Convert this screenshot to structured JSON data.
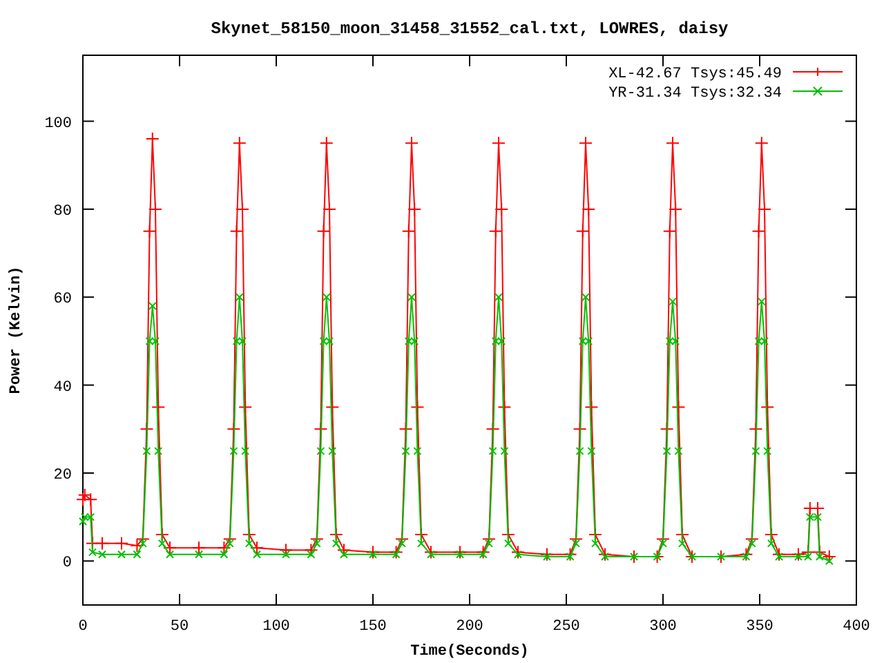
{
  "chart_data": {
    "type": "line",
    "title": "Skynet_58150_moon_31458_31552_cal.txt, LOWRES, daisy",
    "xlabel": "Time(Seconds)",
    "ylabel": "Power (Kelvin)",
    "x": [
      0,
      1,
      4,
      5,
      10,
      20,
      28,
      31,
      33,
      34.5,
      36,
      37.5,
      39,
      41,
      45,
      60,
      73,
      76,
      78,
      79.5,
      81,
      82.5,
      84,
      86,
      90,
      105,
      118,
      121,
      123,
      124.5,
      126,
      127.5,
      129,
      131,
      135,
      150,
      162,
      165,
      167,
      168.5,
      170,
      171.5,
      173,
      175,
      180,
      195,
      207,
      210,
      212,
      213.5,
      215,
      216.5,
      218,
      220,
      225,
      240,
      252,
      255,
      257,
      258.5,
      260,
      261.5,
      263,
      265,
      270,
      285,
      297,
      300,
      302,
      303.5,
      305,
      306.5,
      308,
      310,
      315,
      330,
      343,
      346,
      348,
      349.5,
      351,
      352.5,
      354,
      356,
      360,
      370,
      375,
      376,
      380,
      381,
      386
    ],
    "series": [
      {
        "name": "XL-42.67 Tsys:45.49",
        "color": "#ff0000",
        "marker": "plus",
        "values": [
          14,
          15,
          14,
          4,
          4,
          4,
          3.5,
          5,
          30,
          75,
          96,
          80,
          35,
          6,
          3,
          3,
          3,
          5,
          30,
          75,
          95,
          80,
          35,
          6,
          3,
          2.5,
          2.5,
          5,
          30,
          75,
          95,
          80,
          35,
          6,
          2.5,
          2,
          2,
          5,
          30,
          75,
          95,
          80,
          35,
          6,
          2,
          2,
          2,
          5,
          30,
          75,
          95,
          80,
          35,
          6,
          2,
          1.5,
          1.5,
          5,
          30,
          75,
          95,
          80,
          35,
          6,
          1.5,
          1,
          1,
          5,
          30,
          75,
          95,
          80,
          35,
          6,
          1,
          1,
          1.5,
          5,
          30,
          75,
          95,
          80,
          35,
          6,
          1.5,
          1.5,
          2,
          12,
          12,
          2,
          1
        ]
      },
      {
        "name": "YR-31.34 Tsys:32.34",
        "color": "#00c000",
        "marker": "cross",
        "values": [
          9,
          10,
          10,
          2,
          1.5,
          1.5,
          1.5,
          4,
          25,
          50,
          58,
          50,
          25,
          4,
          1.5,
          1.5,
          1.5,
          4,
          25,
          50,
          60,
          50,
          25,
          4,
          1.5,
          1.5,
          1.5,
          4,
          25,
          50,
          60,
          50,
          25,
          4,
          1.5,
          1.5,
          1.5,
          4,
          25,
          50,
          60,
          50,
          25,
          4,
          1.5,
          1.5,
          1.5,
          4,
          25,
          50,
          60,
          50,
          25,
          4,
          1.5,
          1,
          1,
          4,
          25,
          50,
          60,
          50,
          25,
          4,
          1,
          1,
          1,
          4,
          25,
          50,
          59,
          50,
          25,
          4,
          1,
          1,
          1,
          4,
          25,
          50,
          59,
          50,
          25,
          4,
          1,
          1,
          1,
          10,
          10,
          1,
          0
        ]
      }
    ],
    "legend": true,
    "xlim": [
      0,
      400
    ],
    "ylim": [
      -10,
      115
    ],
    "xticks": [
      0,
      50,
      100,
      150,
      200,
      250,
      300,
      350,
      400
    ],
    "yticks": [
      0,
      20,
      40,
      60,
      80,
      100
    ]
  }
}
